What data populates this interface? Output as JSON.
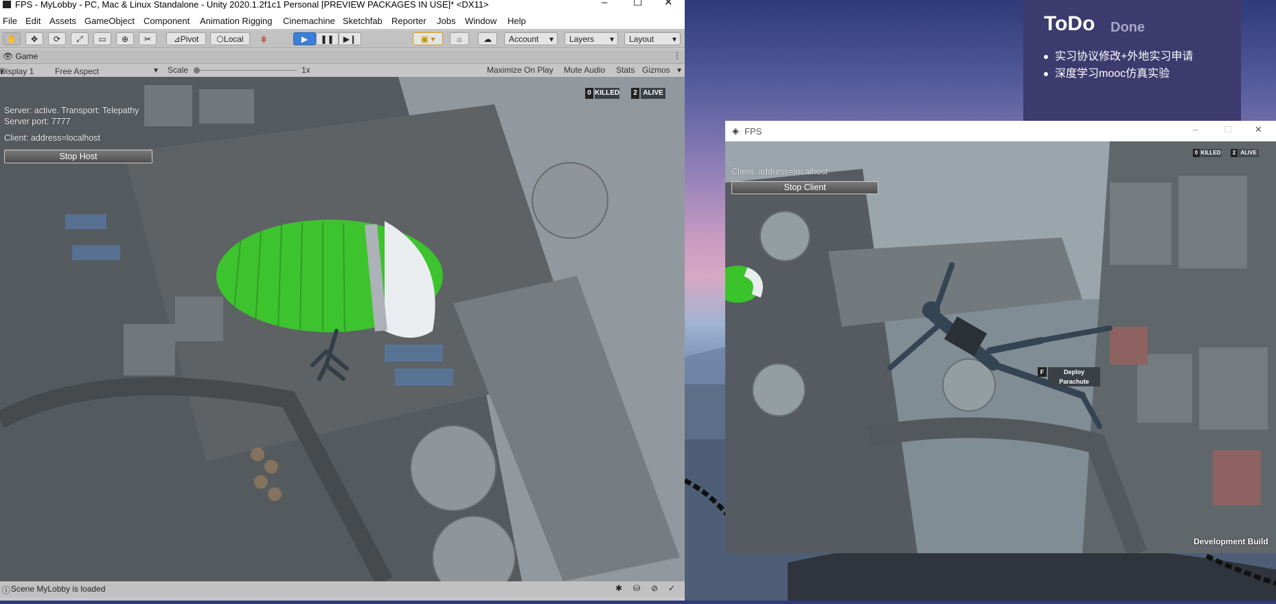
{
  "editor": {
    "window_title": "FPS - MyLobby - PC, Mac & Linux Standalone - Unity 2020.1.2f1c1 Personal [PREVIEW PACKAGES IN USE]* <DX11>",
    "menu": [
      "File",
      "Edit",
      "Assets",
      "GameObject",
      "Component",
      "Animation Rigging",
      "Cinemachine",
      "Sketchfab",
      "Reporter",
      "Jobs",
      "Window",
      "Help"
    ],
    "toolbar": {
      "pivot": "Pivot",
      "local": "Local",
      "account": "Account",
      "layers": "Layers",
      "layout": "Layout"
    },
    "game_tab": "Game",
    "game_bar": {
      "display": "Display 1",
      "aspect": "Free Aspect",
      "scale_label": "Scale",
      "scale_value": "1x",
      "maximize": "Maximize On Play",
      "mute": "Mute Audio",
      "stats": "Stats",
      "gizmos": "Gizmos"
    },
    "hud": {
      "server_line1": "Server: active. Transport: Telepathy",
      "server_line2": "Server port: 7777",
      "client_line": "Client: address=localhost",
      "stop_host": "Stop Host",
      "killed_count": "0",
      "killed_label": "KILLED",
      "alive_count": "2",
      "alive_label": "ALIVE"
    },
    "status": "Scene MyLobby is loaded"
  },
  "build": {
    "title": "FPS",
    "client_line": "Client: address=localhost",
    "stop_client": "Stop Client",
    "killed_count": "0",
    "killed_label": "KILLED",
    "alive_count": "2",
    "alive_label": "ALIVE",
    "prompt_key": "F",
    "prompt_text": "Deploy Parachute",
    "dev_build": "Development Build"
  },
  "todo": {
    "title": "ToDo",
    "done": "Done",
    "items": [
      "实习协议修改+外地实习申请",
      "深度学习mooc仿真实验"
    ]
  },
  "colors": {
    "play_accent": "#3d7fd6",
    "slide_bg": "#3d3a6e",
    "parachute_green": "#31c021"
  }
}
